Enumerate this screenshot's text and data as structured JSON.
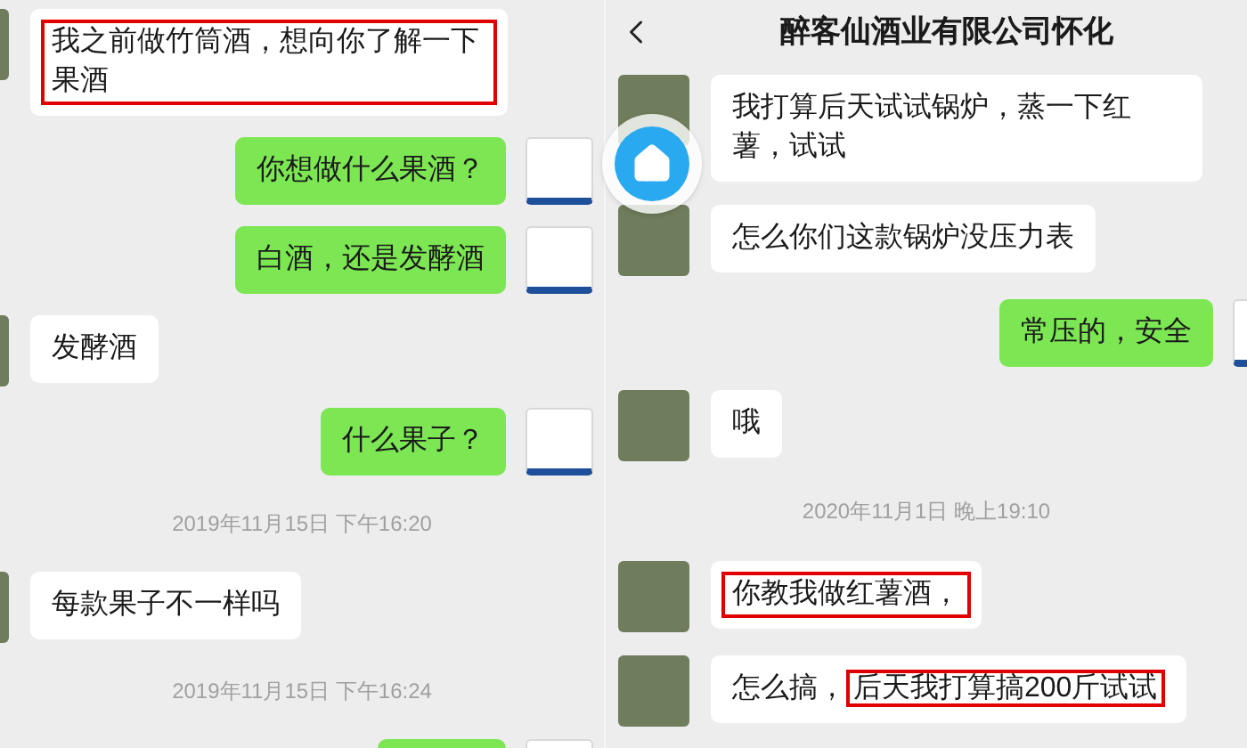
{
  "left_chat": {
    "messages": [
      {
        "kind": "received",
        "parts": [
          {
            "text": "我之前做竹筒酒，想向你了解一下果酒",
            "highlighted": true
          }
        ]
      },
      {
        "kind": "sent",
        "parts": [
          {
            "text": "你想做什么果酒？",
            "highlighted": false
          }
        ]
      },
      {
        "kind": "sent",
        "parts": [
          {
            "text": "白酒，还是发酵酒",
            "highlighted": false
          }
        ]
      },
      {
        "kind": "received",
        "parts": [
          {
            "text": "发酵酒",
            "highlighted": false
          }
        ]
      },
      {
        "kind": "sent",
        "parts": [
          {
            "text": "什么果子？",
            "highlighted": false
          }
        ]
      },
      {
        "kind": "time",
        "text": "2019年11月15日 下午16:20"
      },
      {
        "kind": "received",
        "parts": [
          {
            "text": "每款果子不一样吗",
            "highlighted": false
          }
        ]
      },
      {
        "kind": "time",
        "text": "2019年11月15日 下午16:24"
      },
      {
        "kind": "sent"
      }
    ]
  },
  "right_chat": {
    "title": "醉客仙酒业有限公司怀化",
    "messages": [
      {
        "kind": "received",
        "parts": [
          {
            "text": "我打算后天试试锅炉，蒸一下红薯，试试",
            "highlighted": false
          }
        ]
      },
      {
        "kind": "received",
        "parts": [
          {
            "text": "怎么你们这款锅炉没压力表",
            "highlighted": false
          }
        ]
      },
      {
        "kind": "sent",
        "parts": [
          {
            "text": "常压的，安全",
            "highlighted": false
          }
        ]
      },
      {
        "kind": "received",
        "parts": [
          {
            "text": "哦",
            "highlighted": false
          }
        ]
      },
      {
        "kind": "time",
        "text": "2020年11月1日 晚上19:10"
      },
      {
        "kind": "received",
        "parts": [
          {
            "text": "你教我做红薯酒，",
            "highlighted": true
          }
        ]
      },
      {
        "kind": "received",
        "parts": [
          {
            "text": "怎么搞，",
            "highlighted": false
          },
          {
            "text": "后天我打算搞200斤试试",
            "highlighted": true
          }
        ]
      }
    ]
  }
}
